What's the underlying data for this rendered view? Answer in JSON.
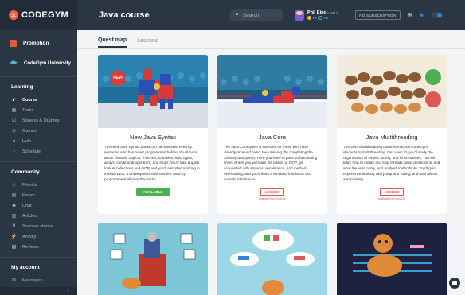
{
  "app": {
    "logo_text": "CODEGYM",
    "page_title": "Java course"
  },
  "header": {
    "search_placeholder": "Search",
    "user_name": "Phil King",
    "user_level": "Level 1",
    "coins": "+9",
    "lights": "+8",
    "subscription_label": "NO SUBSCRIPTION"
  },
  "sidebar": {
    "promotion": "Promotion",
    "university": "CodeGym University",
    "learning_title": "Learning",
    "learning_items": [
      "Course",
      "Tasks",
      "Surveys & Quizzes",
      "Games",
      "Help",
      "Schedule"
    ],
    "community_title": "Community",
    "community_items": [
      "Friends",
      "Forum",
      "Chat",
      "Articles",
      "Success stories",
      "Activity",
      "Reviews"
    ],
    "account_title": "My account",
    "account_items": [
      "Messages"
    ],
    "collapse": "‹"
  },
  "tabs": [
    "Quest map",
    "Lessons"
  ],
  "cards": [
    {
      "title": "New Java Syntax",
      "desc": "The New Java Syntax quest can be mastered even by someone who has never programmed before. You'll learn about classes, objects, methods, variables, data types, arrays, conditional operators, and loops. You'll take a quick look at collections and OOP, and you'll also start working in IntelliJ IDEA, a development environment used by programmers all over the world!",
      "status": "AVAILABLE",
      "badge": "NEW"
    },
    {
      "title": "Java Core",
      "desc": "The Java Core quest is intended for those who have already received basic Java training (by completing the Java Syntax quest). Here you have to pass 10 fascinating levels where you will learn the basics of OOP, get acquainted with streams, serialization, and method overloading, and you'll learn a lot about interfaces and multiple inheritance.",
      "status": "LOCKED",
      "note": "Available from Level 10"
    },
    {
      "title": "Java Multithreading",
      "desc": "The Java Multithreading quest introduces CodeGym students to multithreading. On Level 10, you'll study the organization of Object, String, and inner classes. You will learn how to create and stop threads, what deadlock is, and what the wait, notify, and notifyAll methods do. You'll gain experience working with jsoup and Swing, and learn about autopacking.",
      "status": "LOCKED",
      "note": "Available from Level 20"
    }
  ],
  "colors": {
    "sidebar_bg": "#2b3645",
    "accent_blue": "#2f86d6",
    "available_green": "#4caf50",
    "locked_red": "#e05555",
    "logo_orange": "#ff5e3a"
  }
}
